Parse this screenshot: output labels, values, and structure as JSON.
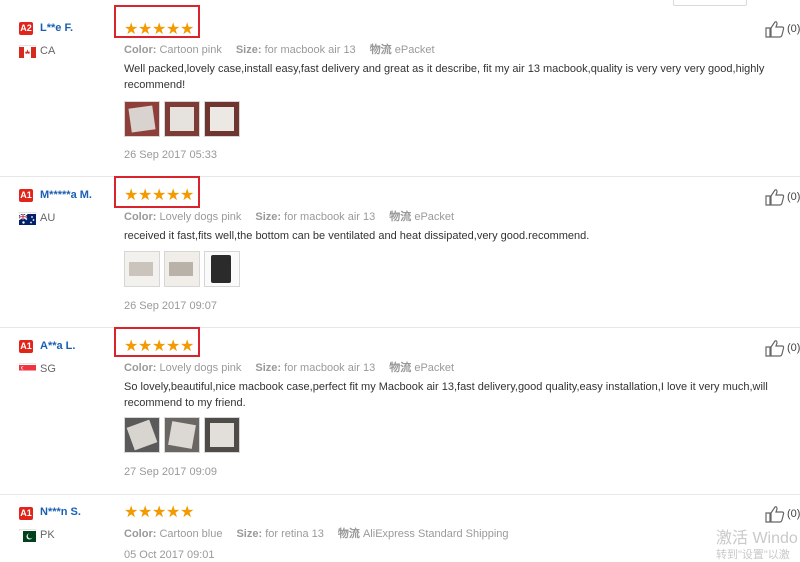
{
  "labels": {
    "color": "Color:",
    "size": "Size:",
    "shipping": "物流"
  },
  "accent_color": "#f39a00",
  "highlight_color": "#d9232d",
  "reviews": [
    {
      "level": "A2",
      "name": "L**e F.",
      "country": "CA",
      "flag_icon": "canada-flag-icon",
      "rating": 5,
      "color": "Cartoon pink",
      "size": "for macbook air 13",
      "shipping": "ePacket",
      "text": "Well packed,lovely case,install easy,fast delivery and great as it describe, fit my air 13 macbook,quality is very very very good,highly recommend!",
      "date": "26 Sep 2017 05:33",
      "helpful": "(0)"
    },
    {
      "level": "A1",
      "name": "M*****a M.",
      "country": "AU",
      "flag_icon": "australia-flag-icon",
      "rating": 5,
      "color": "Lovely dogs pink",
      "size": "for macbook air 13",
      "shipping": "ePacket",
      "text": "received it fast,fits well,the bottom can be ventilated and heat dissipated,very good.recommend.",
      "date": "26 Sep 2017 09:07",
      "helpful": "(0)"
    },
    {
      "level": "A1",
      "name": "A**a L.",
      "country": "SG",
      "flag_icon": "singapore-flag-icon",
      "rating": 5,
      "color": "Lovely dogs pink",
      "size": "for macbook air 13",
      "shipping": "ePacket",
      "text": "So lovely,beautiful,nice macbook case,perfect fit my Macbook air 13,fast delivery,good quality,easy installation,I love it very much,will recommend to my friend.",
      "date": "27 Sep 2017 09:09",
      "helpful": "(0)"
    },
    {
      "level": "A1",
      "name": "N***n S.",
      "country": "PK",
      "flag_icon": "pakistan-flag-icon",
      "rating": 5,
      "color": "Cartoon blue",
      "size": "for retina 13",
      "shipping": "AliExpress Standard Shipping",
      "text": "",
      "date": "05 Oct 2017 09:01",
      "helpful": "(0)"
    }
  ],
  "watermark": {
    "line1": "激活 Windo",
    "line2": "转到\"设置\"以激"
  }
}
